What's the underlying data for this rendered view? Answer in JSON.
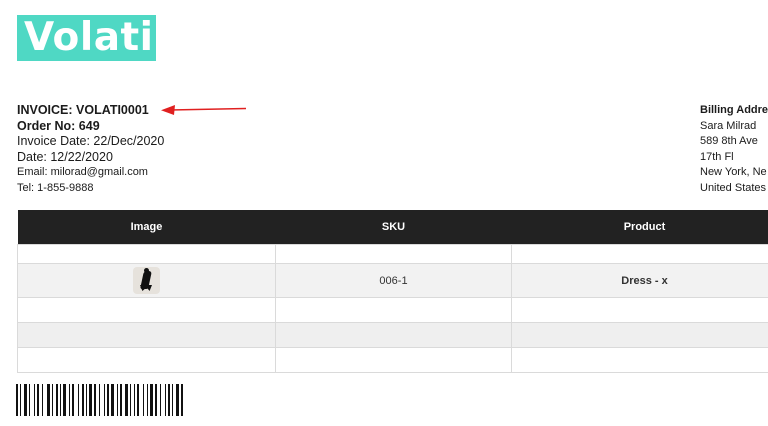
{
  "logo": {
    "text": "Volati",
    "color": "#4fd8c4"
  },
  "invoice": {
    "title": "INVOICE: VOLATI0001",
    "order": "Order No: 649",
    "invoice_date": "Invoice Date: 22/Dec/2020",
    "date": "Date: 12/22/2020",
    "email": "Email: milorad@gmail.com",
    "tel": "Tel: 1-855-9888"
  },
  "billing": {
    "heading": "Billing Addre",
    "lines": [
      "Sara Milrad",
      "589 8th Ave",
      "17th Fl",
      "New York, Ne",
      "United States"
    ]
  },
  "table": {
    "headers": [
      "Image",
      "SKU",
      "Product"
    ],
    "rows": [
      {
        "sku": "",
        "product": ""
      },
      {
        "sku": "006-1",
        "product": "Dress - x",
        "has_image": true
      },
      {
        "sku": "",
        "product": ""
      },
      {
        "sku": "",
        "product": ""
      },
      {
        "sku": "",
        "product": ""
      }
    ]
  },
  "annotation": {
    "icon": "red-arrow-icon",
    "color": "#e02020"
  },
  "barcode": {
    "icon": "barcode-icon"
  }
}
